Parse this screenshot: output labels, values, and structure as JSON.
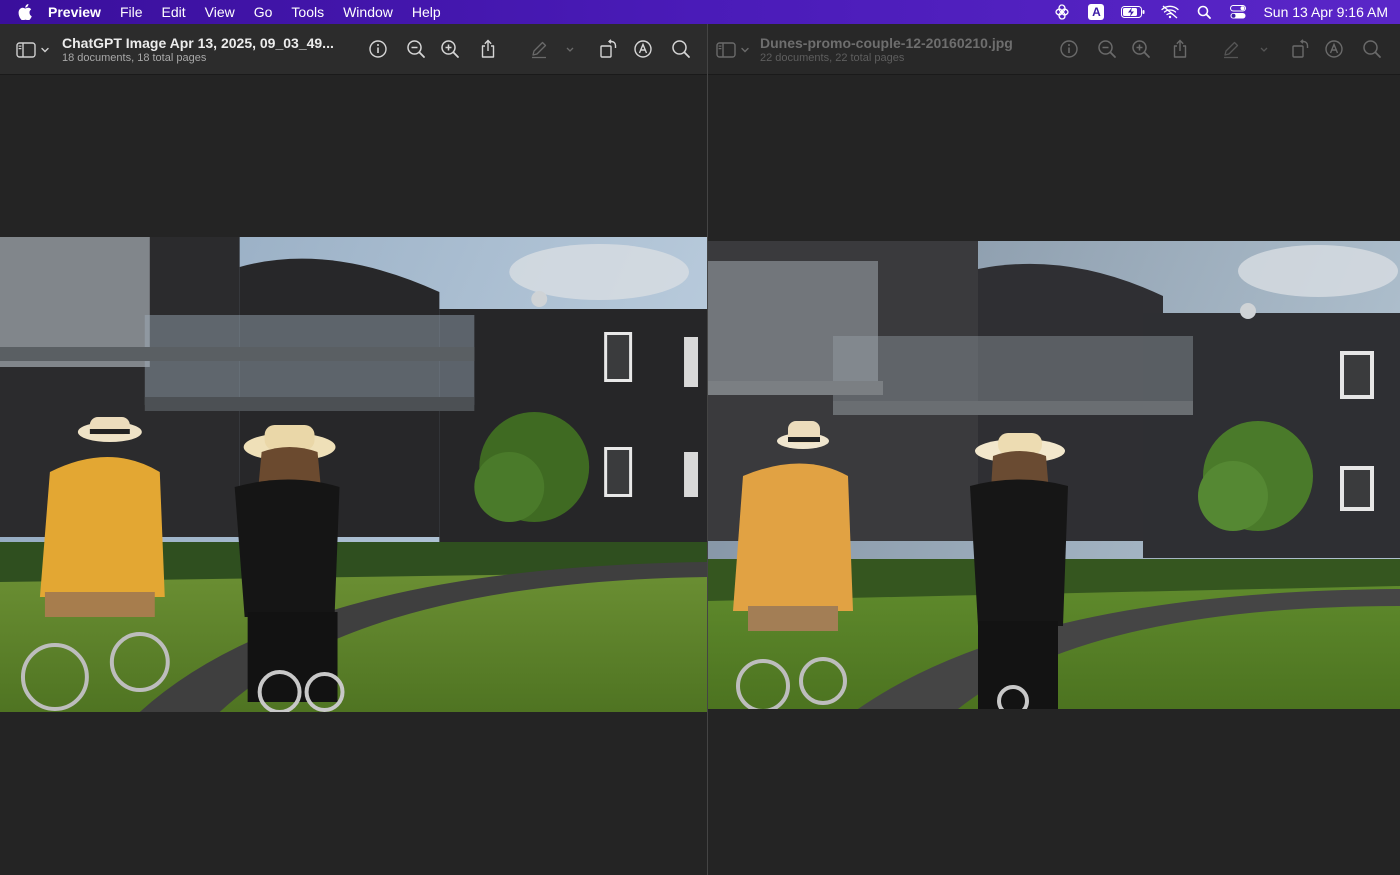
{
  "menubar": {
    "app_name": "Preview",
    "items": [
      "File",
      "Edit",
      "View",
      "Go",
      "Tools",
      "Window",
      "Help"
    ],
    "clock": "Sun 13 Apr  9:16 AM",
    "tray_icons": [
      "copilot-icon",
      "input-source-icon",
      "battery-charging-icon",
      "wifi-off-icon",
      "spotlight-icon",
      "control-center-icon"
    ],
    "input_source_label": "A"
  },
  "windows": {
    "left": {
      "title": "ChatGPT Image Apr 13, 2025, 09_03_49...",
      "subtitle": "18 documents, 18 total pages"
    },
    "right": {
      "title": "Dunes-promo-couple-12-20160210.jpg",
      "subtitle": "22 documents, 22 total pages"
    }
  },
  "toolbar_icons": [
    "info-icon",
    "zoom-out-icon",
    "zoom-in-icon",
    "share-icon",
    "markup-pen-icon",
    "markup-chevron-icon",
    "rotate-icon",
    "markup-toolbar-icon",
    "search-icon"
  ],
  "colors": {
    "menubar": "#4a1bb8",
    "window_bg": "#242424",
    "toolbar_bg": "#2c2c2c"
  }
}
